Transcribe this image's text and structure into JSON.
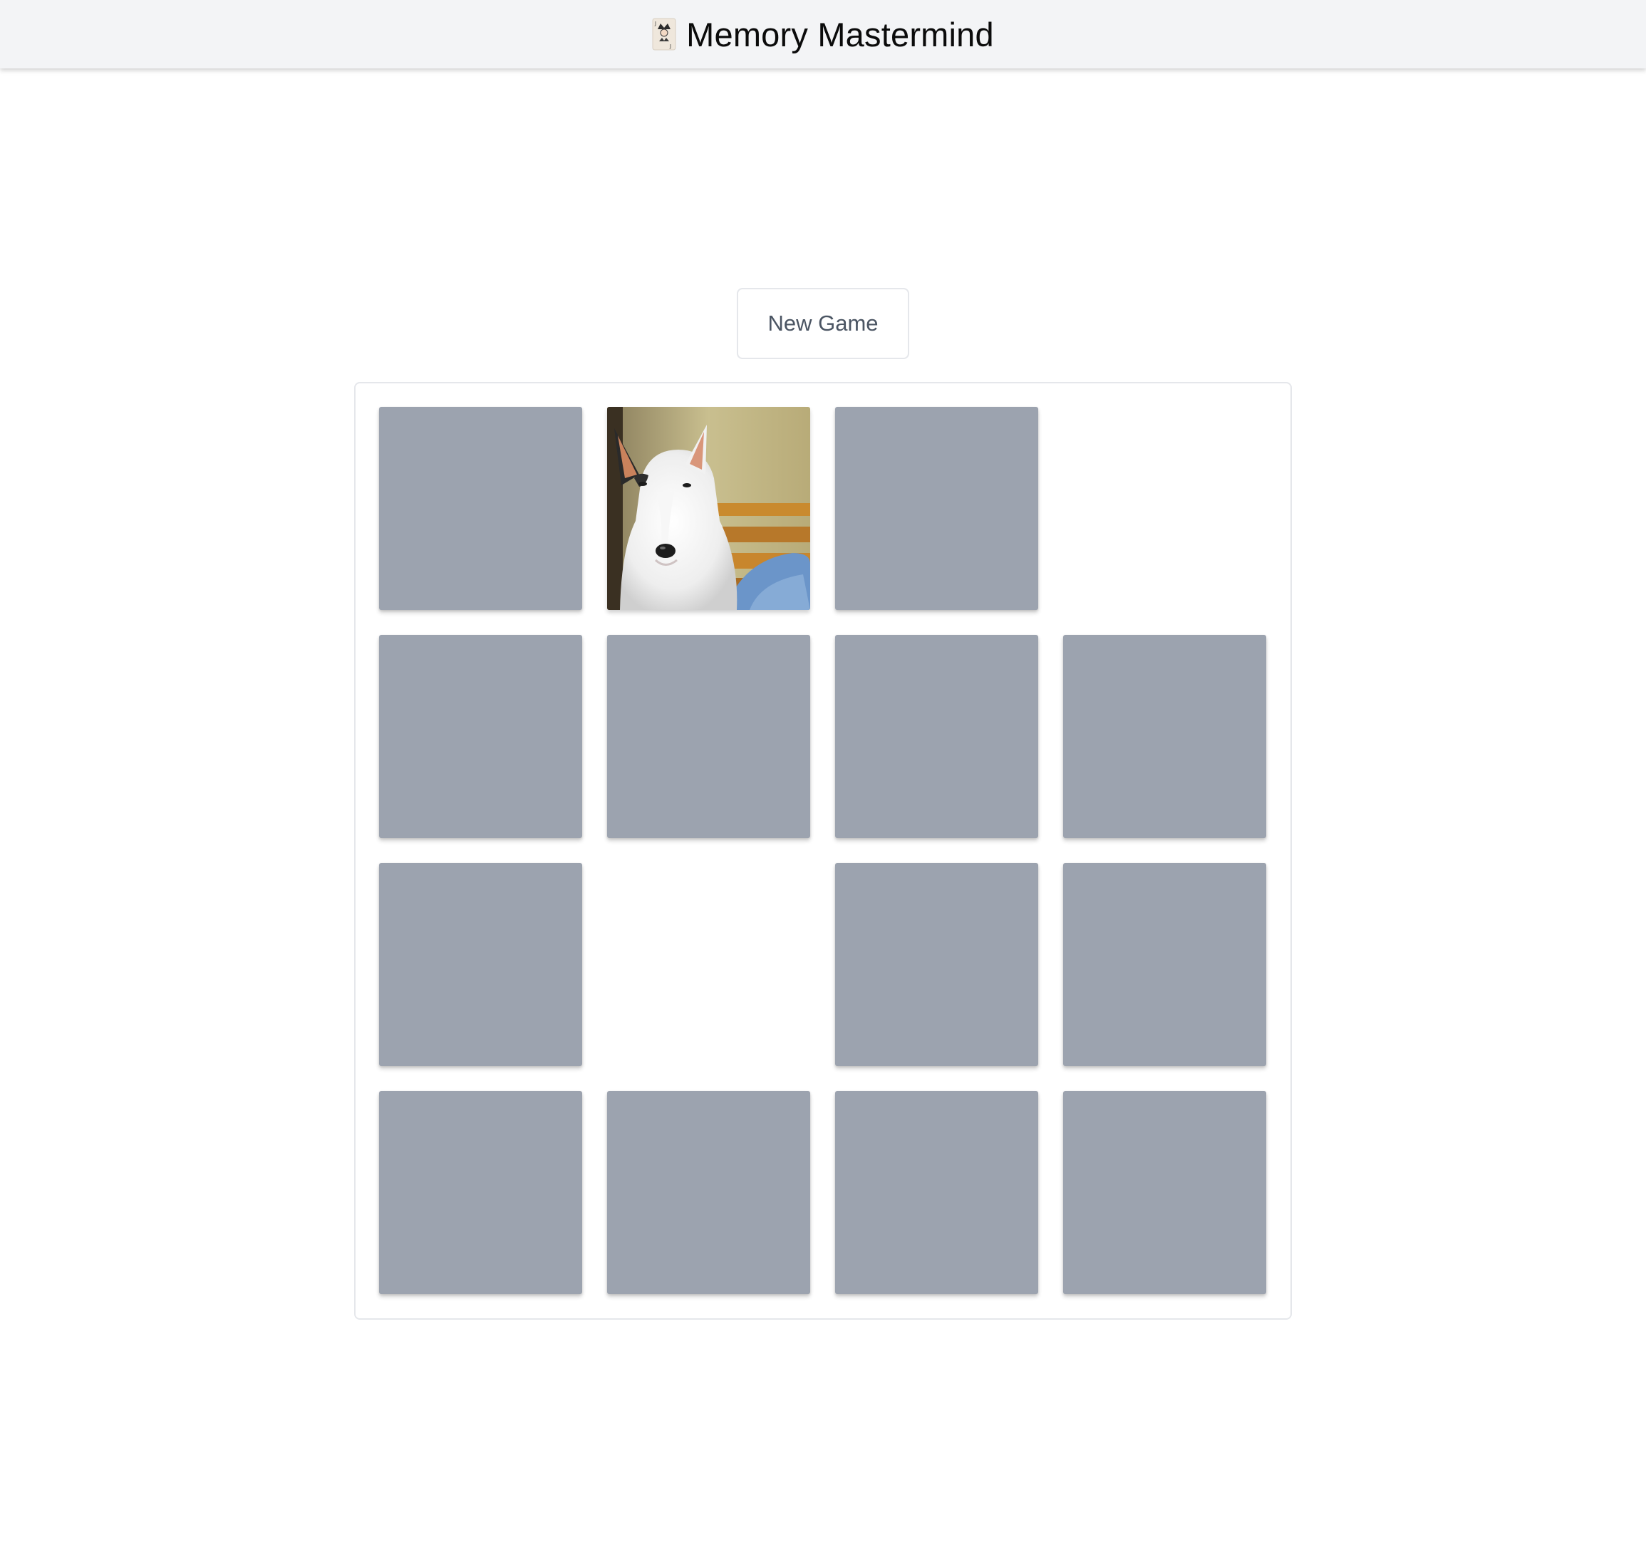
{
  "header": {
    "title": "Memory Mastermind",
    "logo_icon": "joker-card-icon"
  },
  "controls": {
    "new_game_label": "New Game"
  },
  "board": {
    "columns": 4,
    "rows": 4,
    "cards": [
      {
        "state": "hidden"
      },
      {
        "state": "revealed",
        "image": "white-bull-terrier-dog"
      },
      {
        "state": "hidden"
      },
      {
        "state": "matched"
      },
      {
        "state": "hidden"
      },
      {
        "state": "hidden"
      },
      {
        "state": "hidden"
      },
      {
        "state": "hidden"
      },
      {
        "state": "hidden"
      },
      {
        "state": "matched"
      },
      {
        "state": "hidden"
      },
      {
        "state": "hidden"
      },
      {
        "state": "hidden"
      },
      {
        "state": "hidden"
      },
      {
        "state": "hidden"
      },
      {
        "state": "hidden"
      }
    ]
  },
  "colors": {
    "card_back": "#9ca3af",
    "header_bg": "#f3f4f6",
    "border": "#e5e7eb",
    "button_text": "#4b5563"
  }
}
